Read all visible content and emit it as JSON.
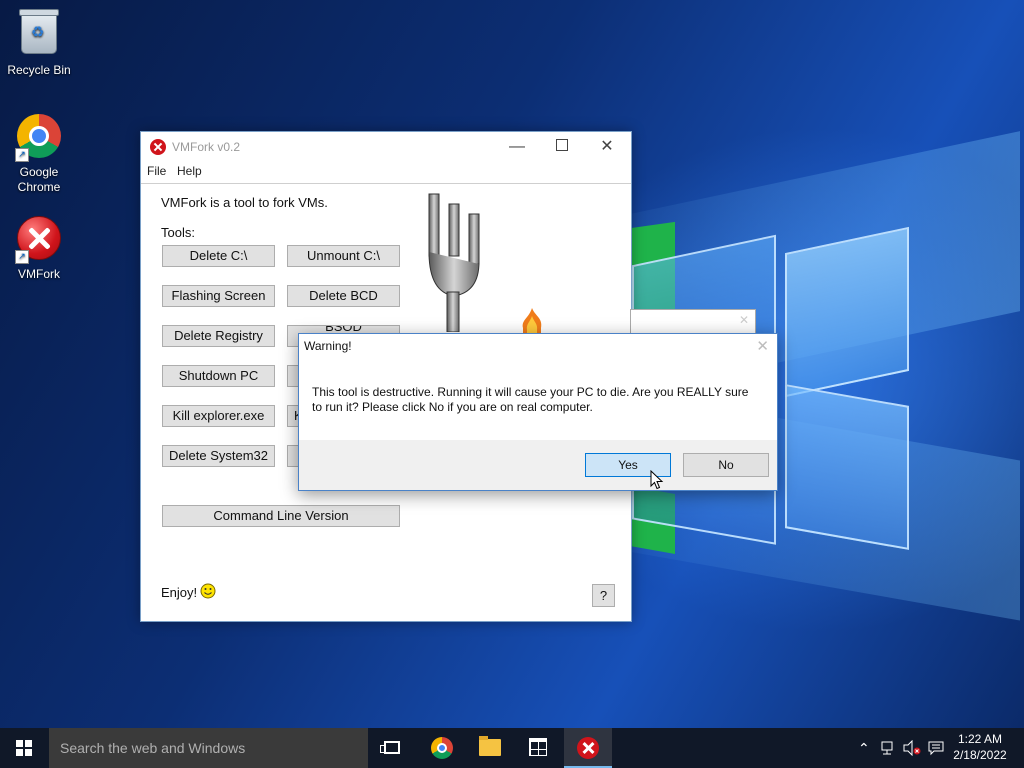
{
  "desktop": {
    "icons": [
      {
        "label": "Recycle Bin"
      },
      {
        "label": "Google Chrome"
      },
      {
        "label": "VMFork"
      }
    ]
  },
  "app_window": {
    "title": "VMFork v0.2",
    "menu": [
      "File",
      "Help"
    ],
    "intro": "VMFork is a tool to fork VMs.",
    "tools_label": "Tools:",
    "buttons": {
      "delete_c": "Delete C:\\",
      "unmount_c": "Unmount C:\\",
      "flashing_screen": "Flashing Screen",
      "delete_bcd": "Delete BCD",
      "delete_registry": "Delete Registry",
      "bsod_partial": "BSOD",
      "shutdown_pc": "Shutdown PC",
      "kill_explorer": "Kill explorer.exe",
      "kill_partial": "K",
      "delete_system32": "Delete System32",
      "command_line": "Command Line Version",
      "help": "?"
    },
    "footer": "Enjoy!"
  },
  "dialog": {
    "title": "Warning!",
    "message": "This tool is destructive. Running it will cause your PC to die. Are you REALLY sure to run it? Please click No if you are on real computer.",
    "yes": "Yes",
    "no": "No"
  },
  "taskbar": {
    "search_placeholder": "Search the web and Windows",
    "time": "1:22 AM",
    "date": "2/18/2022"
  }
}
